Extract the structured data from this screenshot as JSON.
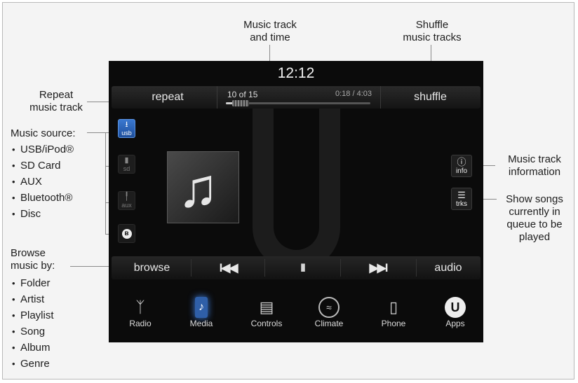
{
  "callouts": {
    "music_track_time": [
      "Music track",
      "and time"
    ],
    "shuffle": [
      "Shuffle",
      "music tracks"
    ],
    "repeat": [
      "Repeat",
      "music track"
    ],
    "music_source_title": "Music source:",
    "music_sources": [
      "USB/iPod®",
      "SD Card",
      "AUX",
      "Bluetooth®",
      "Disc"
    ],
    "browse_title": [
      "Browse",
      "music by:"
    ],
    "browse_options": [
      "Folder",
      "Artist",
      "Playlist",
      "Song",
      "Album",
      "Genre"
    ],
    "info": [
      "Music track",
      "information"
    ],
    "trks": [
      "Show songs",
      "currently in",
      "queue to be",
      "played"
    ]
  },
  "screen": {
    "clock": "12:12",
    "top_bar": {
      "repeat_label": "repeat",
      "shuffle_label": "shuffle",
      "track_number": "10 of 15",
      "track_time": "0:18 / 4:03",
      "progress": 0.074
    },
    "sources": [
      {
        "label": "usb",
        "icon": "usb-icon",
        "glyph": "⭳",
        "active": true
      },
      {
        "label": "sd",
        "icon": "sd-card-icon",
        "glyph": "▮",
        "active": false
      },
      {
        "label": "aux",
        "icon": "aux-icon",
        "glyph": "╿",
        "active": false
      },
      {
        "label": "",
        "icon": "bluetooth-icon",
        "glyph": "ʙ",
        "active": false
      }
    ],
    "album_art_icon": "music-note-icon",
    "right_buttons": {
      "info_label": "info",
      "trks_label": "trks"
    },
    "controls": {
      "browse_label": "browse",
      "previous_glyph": "I◀◀",
      "pause_glyph": "II",
      "next_glyph": "▶▶I",
      "audio_label": "audio"
    },
    "dock": [
      {
        "label": "Radio",
        "icon": "radio-tower-icon"
      },
      {
        "label": "Media",
        "icon": "media-icon"
      },
      {
        "label": "Controls",
        "icon": "controls-icon"
      },
      {
        "label": "Climate",
        "icon": "climate-icon"
      },
      {
        "label": "Phone",
        "icon": "phone-icon"
      },
      {
        "label": "Apps",
        "icon": "apps-icon"
      }
    ]
  },
  "colors": {
    "screen_bg": "#0b0b0b",
    "active_source": "#2f6bc4",
    "text_light": "#e8e8e8"
  }
}
